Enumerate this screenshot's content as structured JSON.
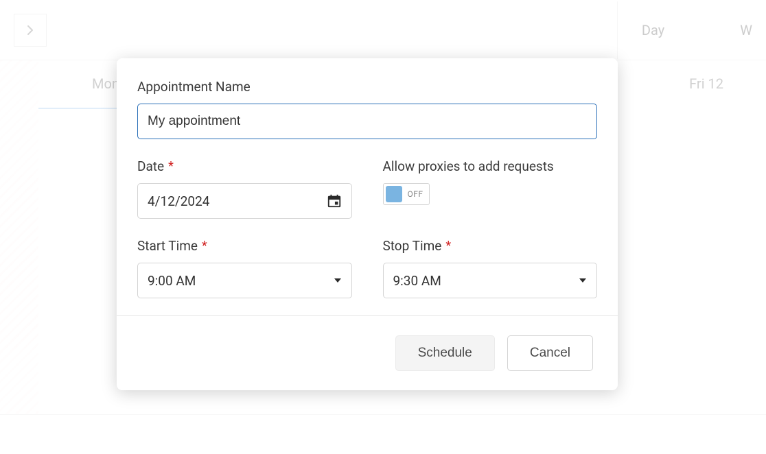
{
  "bg": {
    "views": {
      "day": "Day",
      "week_partial": "W"
    },
    "day_first": "Mon",
    "day_last": "Fri 12"
  },
  "dialog": {
    "labels": {
      "name": "Appointment Name",
      "date": "Date",
      "allow_proxies": "Allow proxies to add requests",
      "start_time": "Start Time",
      "stop_time": "Stop Time"
    },
    "values": {
      "name": "My appointment",
      "date": "4/12/2024",
      "proxies_toggle": "OFF",
      "start_time": "9:00 AM",
      "stop_time": "9:30 AM"
    },
    "buttons": {
      "schedule": "Schedule",
      "cancel": "Cancel"
    }
  }
}
